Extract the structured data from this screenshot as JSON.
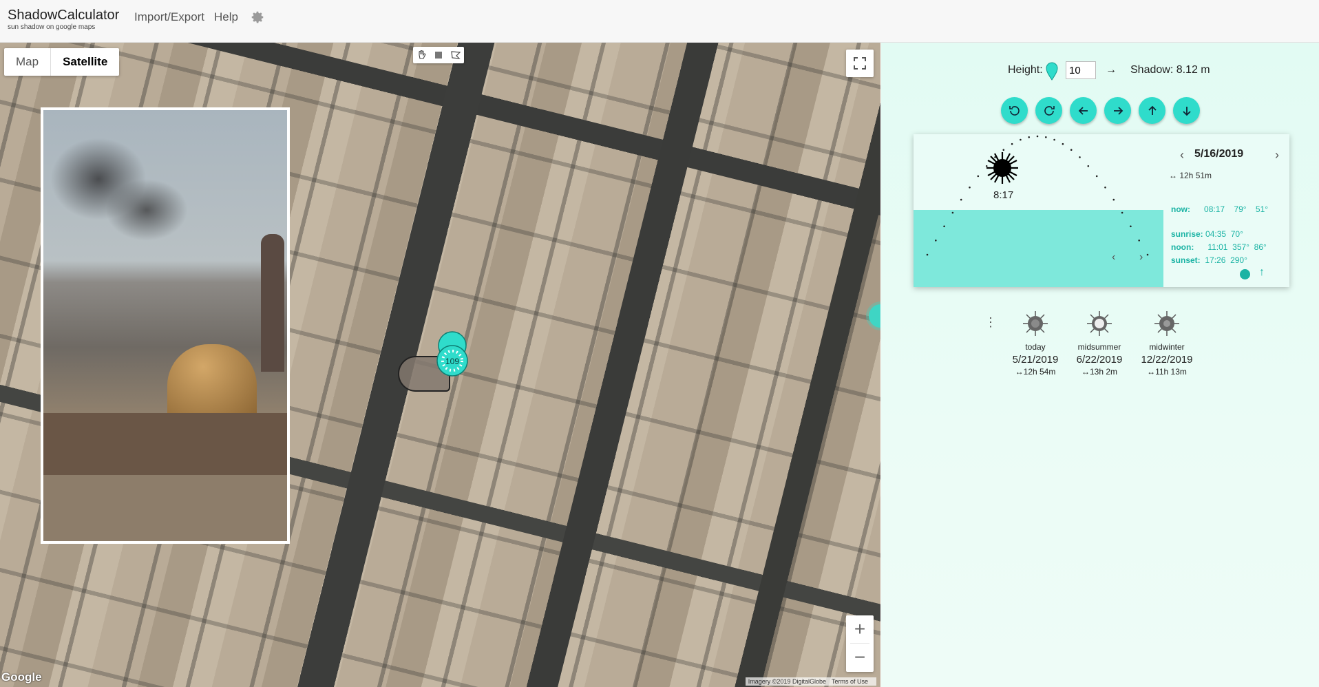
{
  "header": {
    "title": "ShadowCalculator",
    "subtitle": "sun shadow on google maps",
    "nav": [
      "Import/Export",
      "Help"
    ]
  },
  "map": {
    "type_buttons": [
      "Map",
      "Satellite"
    ],
    "active_type": "Satellite",
    "google_logo": "Google",
    "attribution": [
      "Imagery ©2019 DigitalGlobe",
      "Terms of Use"
    ],
    "zoom_in": "+",
    "zoom_out": "−",
    "marker_label": "109"
  },
  "panel": {
    "height_label": "Height:",
    "height_value": "10",
    "arrow": "→",
    "shadow_text": "Shadow: 8.12 m",
    "accent": "#2fdccb",
    "sun_time": "8:17",
    "date": "5/16/2019",
    "day_length": "↔ 12h 51m",
    "now": {
      "label": "now:",
      "time": "08:17",
      "azimuth": "79°",
      "altitude": "51°"
    },
    "sunrise": {
      "label": "sunrise:",
      "time": "04:35",
      "azimuth": "70°"
    },
    "noon": {
      "label": "noon:",
      "time": "11:01",
      "azimuth": "357°",
      "altitude": "86°"
    },
    "sunset": {
      "label": "sunset:",
      "time": "17:26",
      "azimuth": "290°"
    },
    "presets": [
      {
        "label": "today",
        "date": "5/21/2019",
        "length": "↔12h 54m"
      },
      {
        "label": "midsummer",
        "date": "6/22/2019",
        "length": "↔13h 2m"
      },
      {
        "label": "midwinter",
        "date": "12/22/2019",
        "length": "↔11h 13m"
      }
    ]
  },
  "icons": {
    "settings": "gear-icon",
    "rotate_left": "rotate-ccw-icon",
    "rotate_right": "rotate-cw-icon",
    "move_left": "arrow-left-icon",
    "move_right": "arrow-right-icon",
    "move_up": "arrow-up-icon",
    "move_down": "arrow-down-icon"
  }
}
